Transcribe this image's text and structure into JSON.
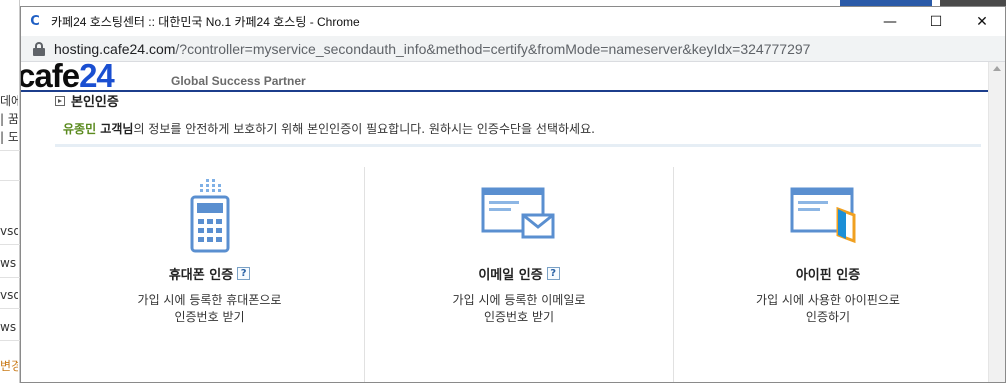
{
  "window": {
    "app_icon_letter": "C",
    "title": "카페24 호스팅센터 :: 대한민국 No.1 카페24 호스팅 - Chrome",
    "minimize_glyph": "—",
    "maximize_glyph": "☐",
    "close_glyph": "✕"
  },
  "address": {
    "host": "hosting.cafe24.com",
    "path": "/?controller=myservice_secondauth_info&method=certify&fromMode=nameserver&keyIdx=324777297"
  },
  "header": {
    "logo_word": "cafe",
    "logo_number": "24",
    "tagline": "Global Success Partner"
  },
  "section": {
    "title": "본인인증",
    "customer_name": "유종민",
    "honorific": " 고객님",
    "message": "의 정보를 안전하게 보호하기 위해 본인인증이 필요합니다. 원하시는 인증수단을 선택하세요."
  },
  "methods": [
    {
      "title": "휴대폰 인증",
      "has_help": true,
      "help_glyph": "?",
      "desc_line1": "가입 시에 등록한 휴대폰으로",
      "desc_line2": "인증번호 받기"
    },
    {
      "title": "이메일 인증",
      "has_help": true,
      "help_glyph": "?",
      "desc_line1": "가입 시에 등록한 이메일로",
      "desc_line2": "인증번호 받기"
    },
    {
      "title": "아이핀 인증",
      "has_help": false,
      "desc_line1": "가입 시에 사용한 아이핀으로",
      "desc_line2": "인증하기"
    }
  ],
  "background_fragments": [
    "데에",
    "| 꿈",
    "| 도",
    "vsdi",
    "ws",
    "vsdi",
    "ws",
    "변경"
  ],
  "icons": {
    "phone": "mobile-phone-icon",
    "email": "email-envelope-icon",
    "ipin": "ipin-card-icon"
  },
  "colors": {
    "brand_blue": "#1a4fd1",
    "header_rule": "#1c3e8c",
    "icon_blue": "#5a8fd0",
    "name_green": "#5a8a1e",
    "ipin_orange": "#f0a020"
  }
}
